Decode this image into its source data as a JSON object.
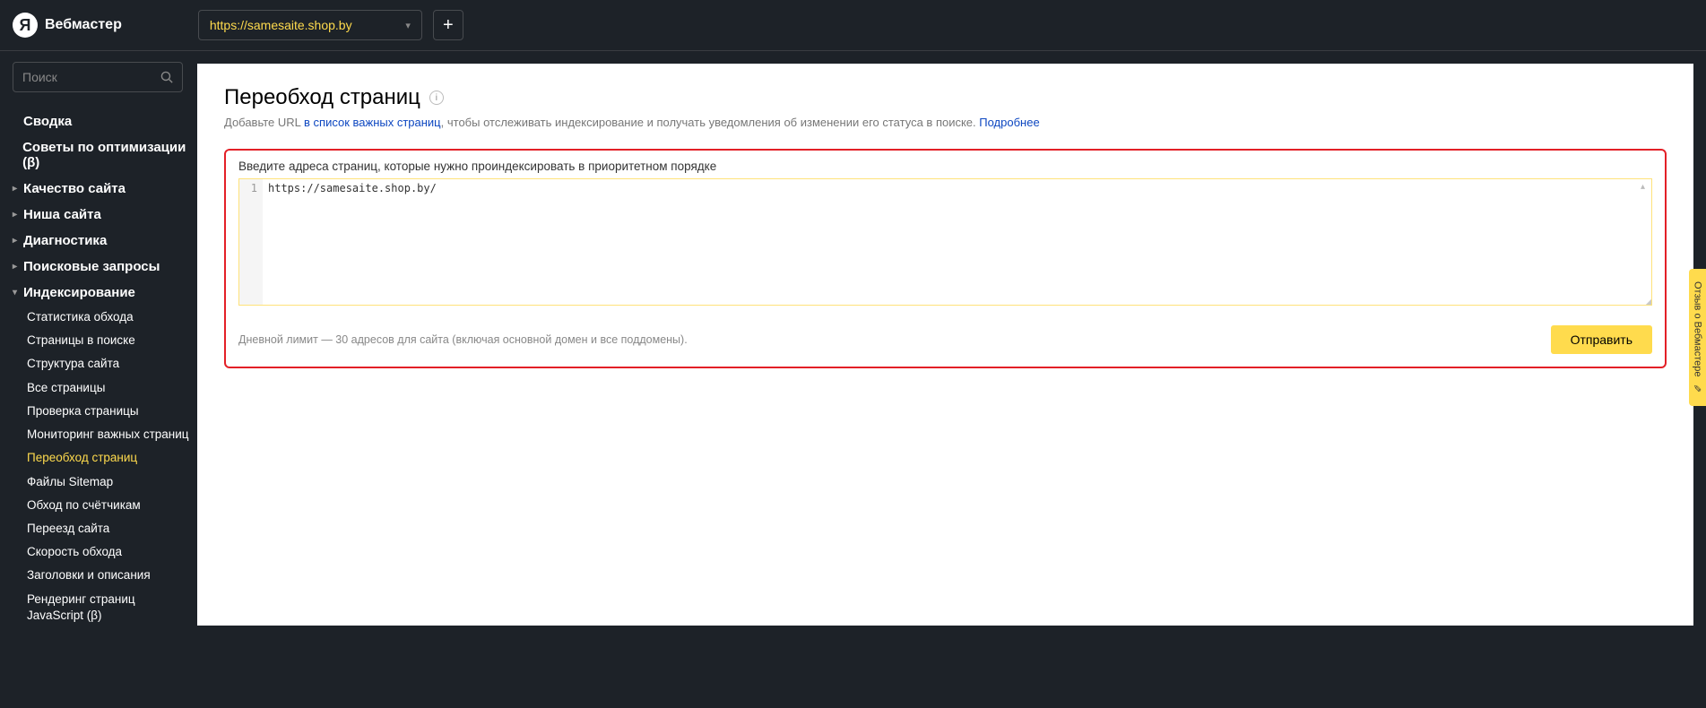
{
  "header": {
    "logo_text": "Вебмастер",
    "logo_letter": "Я",
    "site_url": "https://samesaite.shop.by",
    "add_symbol": "+"
  },
  "search": {
    "placeholder": "Поиск"
  },
  "nav": {
    "summary": "Сводка",
    "advice": "Советы по оптимизации (β)",
    "quality": "Качество сайта",
    "niche": "Ниша сайта",
    "diagnostics": "Диагностика",
    "queries": "Поисковые запросы",
    "indexing": "Индексирование"
  },
  "indexing_sub": [
    "Статистика обхода",
    "Страницы в поиске",
    "Структура сайта",
    "Все страницы",
    "Проверка страницы",
    "Мониторинг важных страниц",
    "Переобход страниц",
    "Файлы Sitemap",
    "Обход по счётчикам",
    "Переезд сайта",
    "Скорость обхода",
    "Заголовки и описания",
    "Рендеринг страниц JavaScript (β)"
  ],
  "indexing_active_idx": 6,
  "main": {
    "title": "Переобход страниц",
    "subtitle_pre": "Добавьте URL ",
    "subtitle_link1": "в список важных страниц",
    "subtitle_mid": ", чтобы отслеживать индексирование и получать уведомления об изменении его статуса в поиске. ",
    "subtitle_link2": "Подробнее",
    "input_label": "Введите адреса страниц, которые нужно проиндексировать в приоритетном порядке",
    "line_no": "1",
    "code_value": "https://samesaite.shop.by/",
    "limit_text": "Дневной лимит — 30 адресов для сайта (включая основной домен и все поддомены).",
    "send_label": "Отправить"
  },
  "feedback": {
    "label": "Отзыв о Вебмастере"
  }
}
